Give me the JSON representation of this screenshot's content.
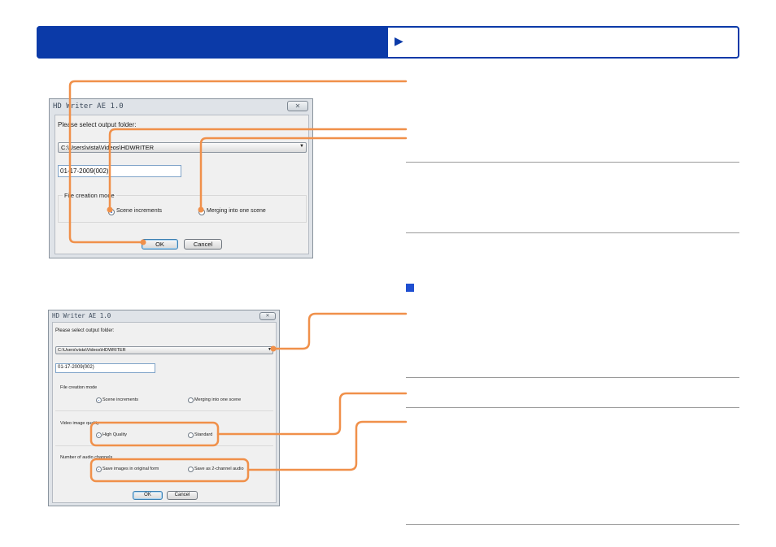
{
  "colors": {
    "header_blue": "#0b3aa8",
    "callout_orange": "#f0904a",
    "bullet_blue": "#1f4fd1"
  },
  "header": {
    "arrow_icon": "right-triangle-icon",
    "arrow_glyph": "▶"
  },
  "dialog1": {
    "title": "HD Writer AE 1.0",
    "close_glyph": "✕",
    "output_folder_label": "Please select output folder:",
    "folder_path": "C:\\Users\\vista\\Videos\\HDWRITER",
    "dropdown_glyph": "▼",
    "name_value": "01-17-2009(002)",
    "file_creation_mode_label": "File creation mode",
    "option_scene_increments": "Scene increments",
    "option_merging": "Merging into one scene",
    "selected_mode": "Scene increments",
    "ok_label": "OK",
    "cancel_label": "Cancel"
  },
  "dialog2": {
    "title": "HD Writer AE 1.0",
    "close_glyph": "✕",
    "output_folder_label": "Please select output folder:",
    "folder_path": "C:\\Users\\vista\\Videos\\HDWRITER",
    "dropdown_glyph": "▼",
    "name_value": "01-17-2009(002)",
    "file_creation_mode_label": "File creation mode",
    "option_scene_increments": "Scene increments",
    "option_merging": "Merging into one scene",
    "video_quality_label": "Video image quality",
    "option_high_quality": "High Quality",
    "option_standard": "Standard",
    "audio_channels_label": "Number of audio channels",
    "option_original_form": "Save images in original form",
    "option_2ch": "Save as 2-channel audio",
    "ok_label": "OK",
    "cancel_label": "Cancel"
  }
}
